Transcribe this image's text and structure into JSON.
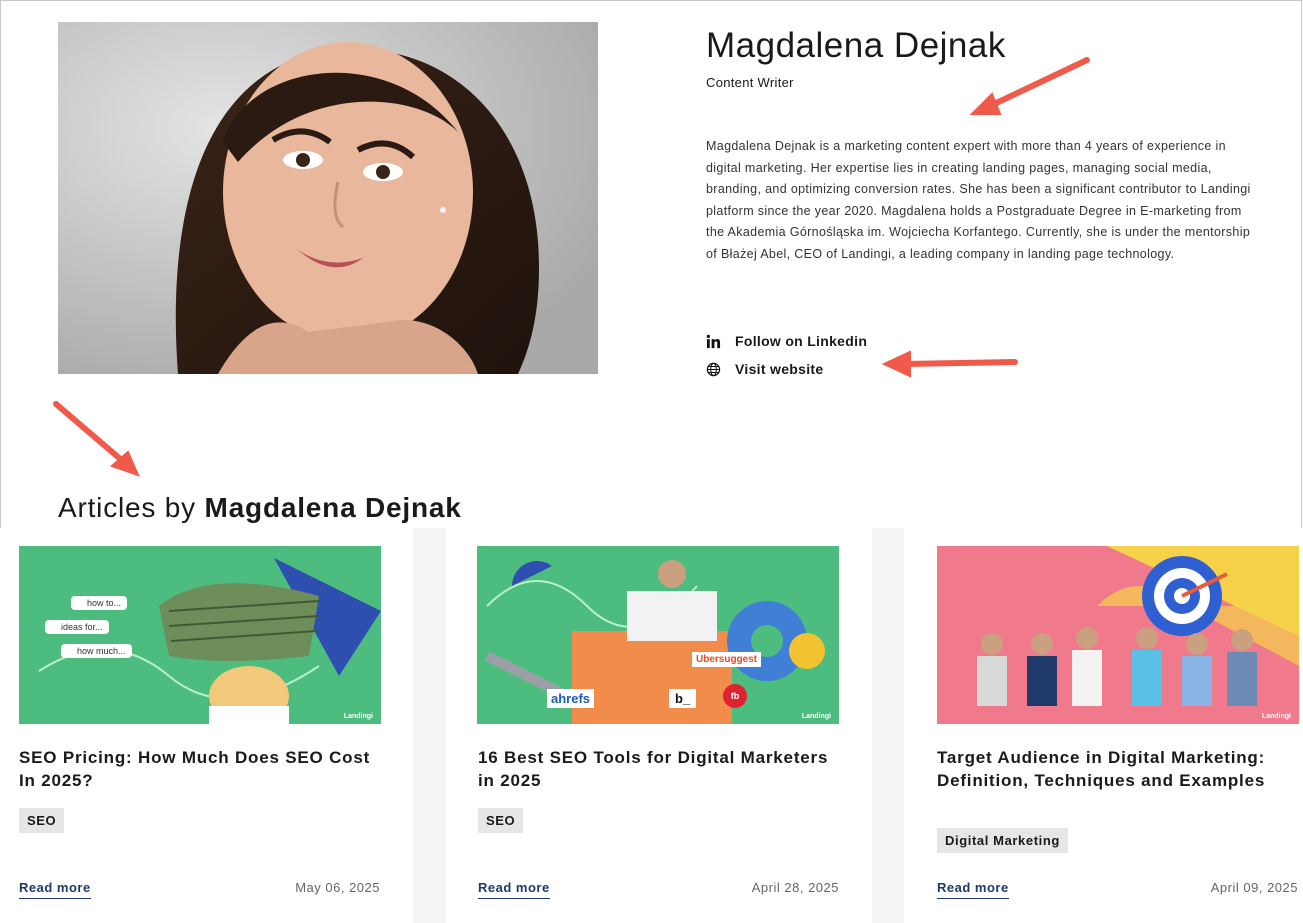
{
  "author": {
    "name": "Magdalena Dejnak",
    "role": "Content Writer",
    "bio": "Magdalena Dejnak is a marketing content expert with more than 4 years of experience in digital marketing. Her expertise lies in creating landing pages, managing social media, branding, and optimizing conversion rates. She has been a significant contributor to Landingi platform since the year 2020. Magdalena holds a Postgraduate Degree in E-marketing from the Akademia Górnośląska im. Wojciecha Korfantego. Currently, she is under the mentorship of Błażej Abel, CEO of Landingi, a leading company in landing page technology.",
    "links": [
      {
        "label": "Follow on Linkedin",
        "icon": "linkedin-icon"
      },
      {
        "label": "Visit website",
        "icon": "globe-icon"
      }
    ]
  },
  "articles_section": {
    "heading_prefix": "Articles by",
    "heading_name": "Magdalena Dejnak"
  },
  "articles": [
    {
      "title": "SEO Pricing: How Much Does SEO Cost In 2025?",
      "tag": "SEO",
      "read_more": "Read more",
      "date": "May 06, 2025",
      "thumb_chips": [
        "how to...",
        "ideas for...",
        "how much..."
      ],
      "thumb_brand": "Landingi",
      "thumb_bg": "#4dbd7f"
    },
    {
      "title": "16 Best SEO Tools for Digital Marketers in 2025",
      "tag": "SEO",
      "read_more": "Read more",
      "date": "April 28, 2025",
      "thumb_logos": [
        "Ubersuggest",
        "ahrefs",
        "b_",
        "fb"
      ],
      "thumb_brand": "Landingi",
      "thumb_bg": "#4dbd7f"
    },
    {
      "title": "Target Audience in Digital Marketing: Definition, Techniques and Examples",
      "tag": "Digital Marketing",
      "read_more": "Read more",
      "date": "April 09, 2025",
      "thumb_brand": "Landingi",
      "thumb_bg": "#f07a8c"
    }
  ],
  "colors": {
    "accent_arrow": "#ef5a4a",
    "link_blue": "#1f3a6a",
    "tag_bg": "#e6e6e6"
  }
}
